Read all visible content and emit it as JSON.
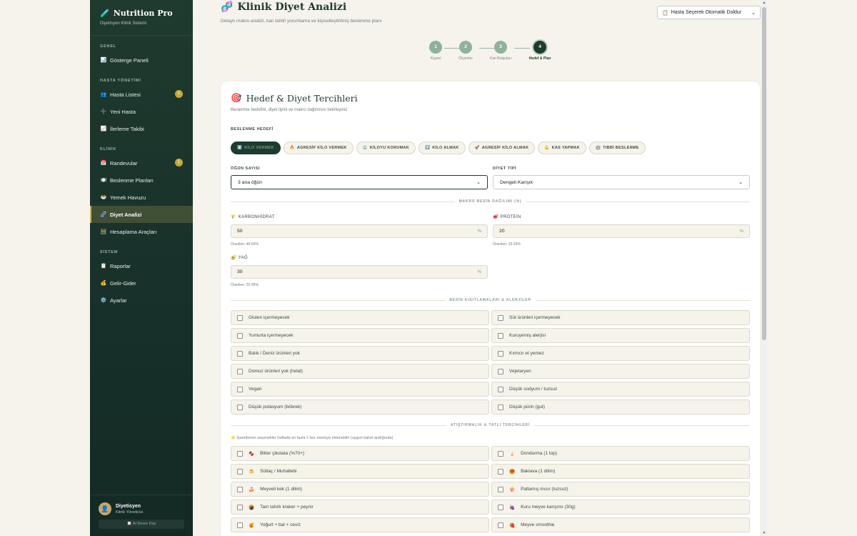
{
  "sidebar": {
    "brand_title": "Nutrition Pro",
    "brand_sub": "Diyetisyen Klinik Sistemi",
    "sections": {
      "genel": "GENEL",
      "hasta": "HASTA YÖNETİMİ",
      "klinik": "KLİNİK",
      "sistem": "SİSTEM"
    },
    "items": {
      "dashboard": "Gösterge Paneli",
      "patients": "Hasta Listesi",
      "patients_badge": "1",
      "new_patient": "Yeni Hasta",
      "progress": "İlerleme Takibi",
      "appointments": "Randevular",
      "appointments_badge": "1",
      "plans": "Beslenme Planları",
      "foods": "Yemek Havuzu",
      "analysis": "Diyet Analizi",
      "calc": "Hesaplama Araçları",
      "reports": "Raporlar",
      "finance": "Gelir-Gider",
      "settings": "Ayarlar"
    },
    "user": {
      "name": "Diyetisyen",
      "role": "Klinik Yöneticisi",
      "ai_status": "🔲 AI Devre Dışı"
    }
  },
  "header": {
    "title": "Klinik Diyet Analizi",
    "subtitle": "Detaylı makro analizi, kan tahlili yorumlama ve kişiselleştirilmiş beslenme planı",
    "autofill": "Hasta Seçerek Otomatik Doldur"
  },
  "stepper": [
    {
      "num": "1",
      "label": "Kişisel"
    },
    {
      "num": "2",
      "label": "Ölçümler"
    },
    {
      "num": "3",
      "label": "Kan Bulguları"
    },
    {
      "num": "4",
      "label": "Hedef & Plan"
    }
  ],
  "card": {
    "title": "Hedef & Diyet Tercihleri",
    "subtitle": "Beslenme hedefini, diyet tipini ve makro dağılımını belirleyiniz",
    "goal_label": "BESLENME HEDEFİ",
    "goals": [
      {
        "icon": "⬇️",
        "label": "KİLO VERMEK"
      },
      {
        "icon": "🔥",
        "label": "AGRESİF KİLO VERMEK"
      },
      {
        "icon": "⚖️",
        "label": "KİLOYU KORUMAK"
      },
      {
        "icon": "⬆️",
        "label": "KİLO ALMAK"
      },
      {
        "icon": "🚀",
        "label": "AGRESİF KİLO ALMAK"
      },
      {
        "icon": "💪",
        "label": "KAS YAPMAK"
      },
      {
        "icon": "🏥",
        "label": "TIBBİ BESLENME"
      }
    ],
    "meal_label": "ÖĞÜN SAYISI",
    "meal_value": "3 ana öğün",
    "diet_label": "DİYET TİPİ",
    "diet_value": "Dengeli Karışık",
    "macro_title": "MAKRO BESİN DAĞILIMI (%)",
    "macros": {
      "carb_label": "KARBONHİDRAT",
      "carb_value": "50",
      "carb_hint": "Önerilen: 45-60%",
      "protein_label": "PROTEİN",
      "protein_value": "20",
      "protein_hint": "Önerilen: 15-25%",
      "fat_label": "YAĞ",
      "fat_value": "30",
      "fat_hint": "Önerilen: 25-35%",
      "unit": "%"
    },
    "restrictions_title": "BESİN KISITLAMALARI & ALERJİLER",
    "restrictions": [
      "Gluten içermeyecek",
      "Süt ürünleri içermeyecek",
      "Yumurta içermeyecek",
      "Kuruyemiş alerjisi",
      "Balık / Deniz ürünleri yok",
      "Kırmızı et yemez",
      "Domuz ürünleri yok (helal)",
      "Vejetaryen",
      "Vegan",
      "Düşük sodyum / tuzsuz",
      "Düşük potasyum (böbrek)",
      "Düşük pürin (gut)"
    ],
    "snacks_title": "ATIŞTIRMALIK & TATLI TERCİHLERİ",
    "snacks_note": "⭐ İşaretlenen seçenekler haftada en fazla 1 kez menüye eklenebilir (uygun kalori aralığında)",
    "snacks": [
      {
        "icon": "🍫",
        "label": "Bitter çikolata (%70+)"
      },
      {
        "icon": "🍦",
        "label": "Dondurma (1 top)"
      },
      {
        "icon": "🍮",
        "label": "Sütlaç / Muhallebi"
      },
      {
        "icon": "🥮",
        "label": "Baklava (1 dilim)"
      },
      {
        "icon": "🍰",
        "label": "Meyveli kek (1 dilim)"
      },
      {
        "icon": "🍿",
        "label": "Patlamış mısır (tuzsuz)"
      },
      {
        "icon": "🍘",
        "label": "Tam tahıllı kraker + peynir"
      },
      {
        "icon": "🍇",
        "label": "Kuru meyve karışımı (30g)"
      },
      {
        "icon": "🍯",
        "label": "Yoğurt + bal + ceviz"
      },
      {
        "icon": "🍓",
        "label": "Meyve smoothie"
      }
    ]
  }
}
